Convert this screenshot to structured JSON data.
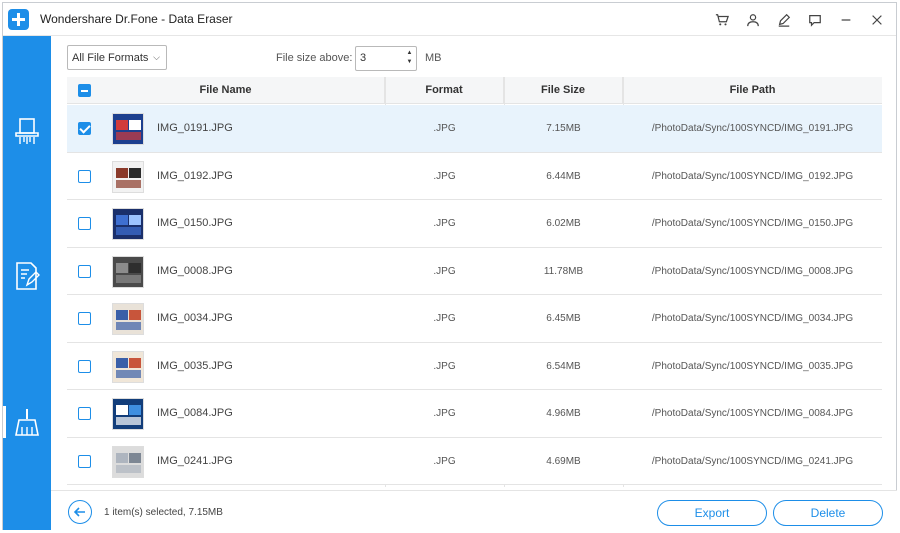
{
  "app": {
    "title": "Wondershare Dr.Fone - Data Eraser"
  },
  "titlebar_icons": [
    "cart-icon",
    "user-icon",
    "edit-icon",
    "feedback-icon",
    "minimize-icon",
    "close-icon"
  ],
  "sidebar": {
    "items": [
      {
        "icon": "erase-all-data-icon",
        "active": false
      },
      {
        "icon": "erase-private-data-icon",
        "active": false
      },
      {
        "icon": "free-up-space-icon",
        "active": true
      }
    ]
  },
  "filter": {
    "format_selected": "All File Formats",
    "size_label": "File size above:",
    "size_value": "3",
    "size_unit": "MB"
  },
  "table": {
    "headers": {
      "name": "File Name",
      "format": "Format",
      "size": "File Size",
      "path": "File Path"
    },
    "rows": [
      {
        "name": "IMG_0191.JPG",
        "format": ".JPG",
        "size": "7.15MB",
        "path": "/PhotoData/Sync/100SYNCD/IMG_0191.JPG",
        "checked": true
      },
      {
        "name": "IMG_0192.JPG",
        "format": ".JPG",
        "size": "6.44MB",
        "path": "/PhotoData/Sync/100SYNCD/IMG_0192.JPG",
        "checked": false
      },
      {
        "name": "IMG_0150.JPG",
        "format": ".JPG",
        "size": "6.02MB",
        "path": "/PhotoData/Sync/100SYNCD/IMG_0150.JPG",
        "checked": false
      },
      {
        "name": "IMG_0008.JPG",
        "format": ".JPG",
        "size": "11.78MB",
        "path": "/PhotoData/Sync/100SYNCD/IMG_0008.JPG",
        "checked": false
      },
      {
        "name": "IMG_0034.JPG",
        "format": ".JPG",
        "size": "6.45MB",
        "path": "/PhotoData/Sync/100SYNCD/IMG_0034.JPG",
        "checked": false
      },
      {
        "name": "IMG_0035.JPG",
        "format": ".JPG",
        "size": "6.54MB",
        "path": "/PhotoData/Sync/100SYNCD/IMG_0035.JPG",
        "checked": false
      },
      {
        "name": "IMG_0084.JPG",
        "format": ".JPG",
        "size": "4.96MB",
        "path": "/PhotoData/Sync/100SYNCD/IMG_0084.JPG",
        "checked": false
      },
      {
        "name": "IMG_0241.JPG",
        "format": ".JPG",
        "size": "4.69MB",
        "path": "/PhotoData/Sync/100SYNCD/IMG_0241.JPG",
        "checked": false
      }
    ]
  },
  "footer": {
    "status": "1 item(s) selected, 7.15MB",
    "export_label": "Export",
    "delete_label": "Delete"
  },
  "colors": {
    "accent": "#1d8ee8",
    "selected_row": "#e8f3fc"
  }
}
